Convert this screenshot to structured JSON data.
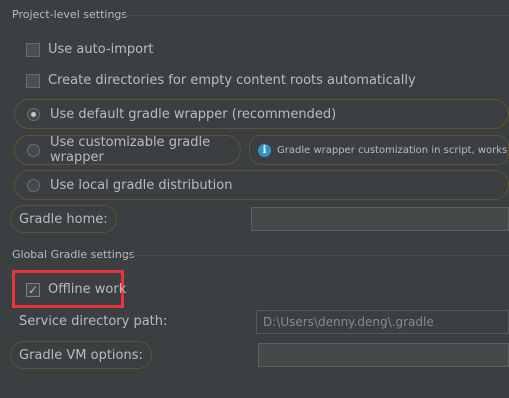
{
  "project_settings": {
    "title": "Project-level settings",
    "use_auto_import": {
      "label": "Use auto-import",
      "checked": false
    },
    "create_dirs": {
      "label": "Create directories for empty content roots automatically",
      "checked": false
    },
    "wrapper_options": [
      {
        "label": "Use default gradle wrapper (recommended)",
        "selected": true
      },
      {
        "label": "Use customizable gradle wrapper",
        "selected": false
      },
      {
        "label": "Use local gradle distribution",
        "selected": false
      }
    ],
    "wrapper_info": "Gradle wrapper customization in script, works with Gradle",
    "gradle_home": {
      "label": "Gradle home:",
      "value": ""
    }
  },
  "global_settings": {
    "title": "Global Gradle settings",
    "offline_work": {
      "label": "Offline work",
      "checked": true
    },
    "service_directory": {
      "label": "Service directory path:",
      "value": "D:\\Users\\denny.deng\\.gradle"
    },
    "vm_options": {
      "label": "Gradle VM options:",
      "value": ""
    }
  },
  "colors": {
    "background": "#3c3f41",
    "highlight": "#e8343a",
    "info_icon": "#3592c4"
  },
  "icons": {
    "checkmark": "✓",
    "info": "i"
  }
}
